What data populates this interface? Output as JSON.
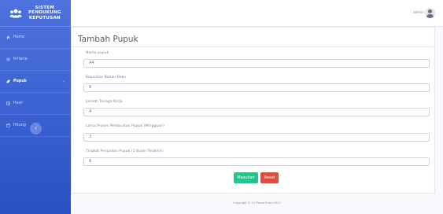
{
  "sidebar": {
    "brand_line1": "SISTEM",
    "brand_line2": "PENDUKUNG",
    "brand_line3": "KEPUTUSAN",
    "items": [
      {
        "label": "Home",
        "icon": "home-icon"
      },
      {
        "label": "Kriteria",
        "icon": "list-icon"
      },
      {
        "label": "Pupuk",
        "icon": "leaf-icon"
      },
      {
        "label": "Hasil",
        "icon": "table-icon"
      },
      {
        "label": "Hitung",
        "icon": "calculator-icon"
      }
    ],
    "active_item": "Pupuk",
    "toggle_glyph": "‹"
  },
  "topbar": {
    "user_name": "admin"
  },
  "form": {
    "title": "Tambah Pupuk",
    "fields": [
      {
        "label": "Nama pupuk",
        "value": "A4"
      },
      {
        "label": "Kapasitas Bahan Baku",
        "value": "6"
      },
      {
        "label": "Jumlah Tenaga Kerja",
        "value": "4"
      },
      {
        "label": "Lama Proses Pembuatan Pupuk (Mingguan)",
        "value": "3"
      },
      {
        "label": "Tingkat Penjualan Pupuk (1 Bulan Terakhir)",
        "value": "8"
      }
    ],
    "submit_label": "Masukan",
    "reset_label": "Reset"
  },
  "footer": {
    "text": "Copyright © CV Prima Putra 2022"
  },
  "colors": {
    "sidebar": "#4e73df",
    "submit": "#1cc88a",
    "reset": "#e74a3b"
  }
}
